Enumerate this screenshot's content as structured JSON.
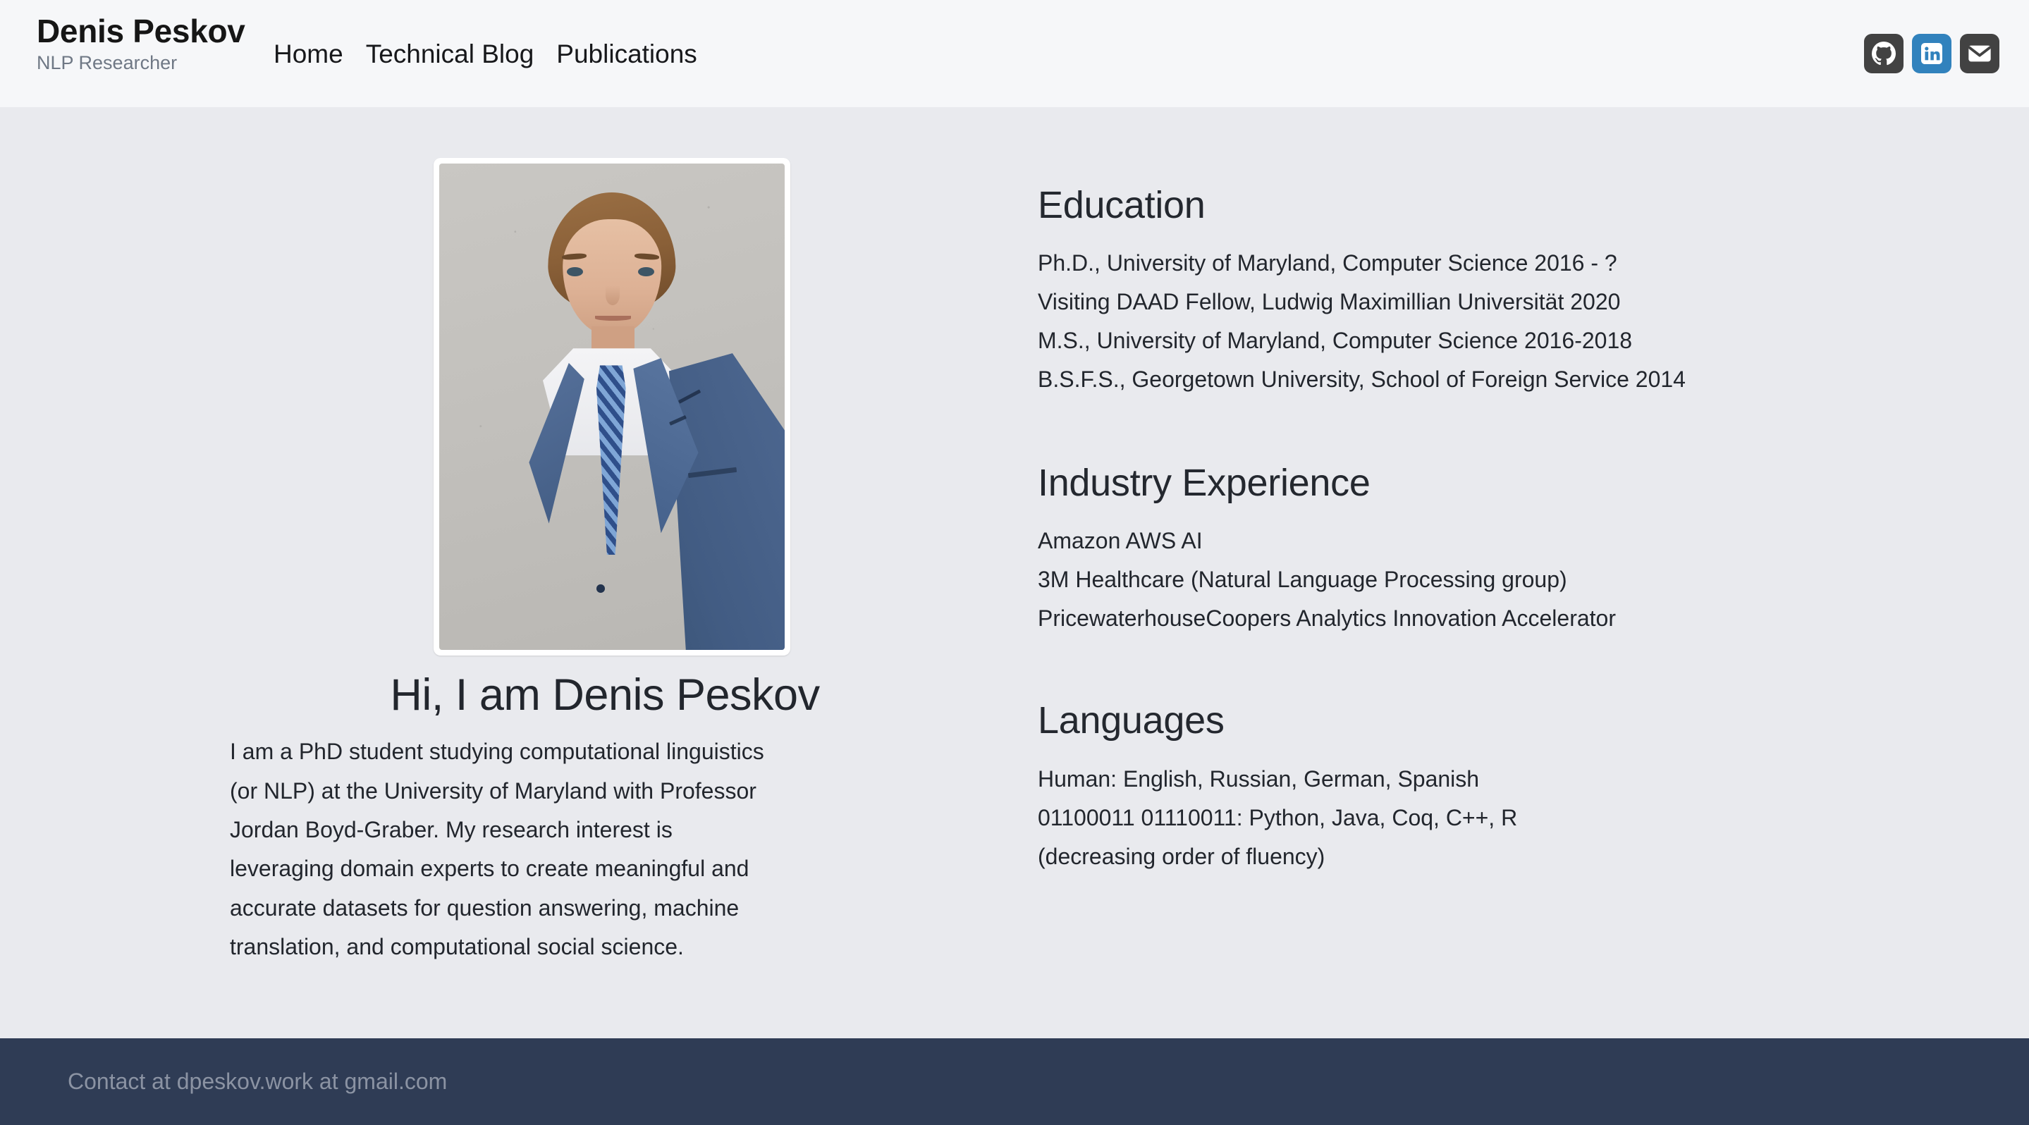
{
  "header": {
    "brand_name": "Denis Peskov",
    "brand_subtitle": "NLP Researcher",
    "nav": [
      {
        "label": "Home",
        "name": "nav-home"
      },
      {
        "label": "Technical Blog",
        "name": "nav-technical-blog"
      },
      {
        "label": "Publications",
        "name": "nav-publications"
      }
    ],
    "social": [
      {
        "icon": "github-icon",
        "color": "#424242"
      },
      {
        "icon": "linkedin-icon",
        "color": "#3182bd"
      },
      {
        "icon": "email-icon",
        "color": "#424242"
      }
    ]
  },
  "hero": {
    "photo_alt": "portrait-photo",
    "title": "Hi, I am Denis Peskov",
    "paragraph": "I am a PhD student studying computational linguistics (or NLP) at the University of Maryland with Professor Jordan Boyd-Graber. My research interest is leveraging domain experts to create meaningful and accurate datasets for question answering, machine translation, and computational social science."
  },
  "education": {
    "title": "Education",
    "lines": [
      "Ph.D., University of Maryland, Computer Science 2016 - ?",
      "Visiting DAAD Fellow, Ludwig Maximillian Universität 2020",
      "M.S., University of Maryland, Computer Science 2016-2018",
      "B.S.F.S., Georgetown University, School of Foreign Service 2014"
    ]
  },
  "industry": {
    "title": "Industry Experience",
    "lines": [
      "Amazon AWS AI",
      "3M Healthcare (Natural Language Processing group)",
      "PricewaterhouseCoopers Analytics Innovation Accelerator"
    ]
  },
  "languages": {
    "title": "Languages",
    "lines": [
      "Human: English, Russian, German, Spanish",
      "01100011 01110011: Python, Java, Coq, C++, R",
      "(decreasing order of fluency)"
    ]
  },
  "footer": {
    "contact": "Contact at dpeskov.work at gmail.com"
  },
  "colors": {
    "header_bg": "#f6f7f9",
    "page_bg": "#e9eaee",
    "footer_bg": "#2f3c55",
    "footer_text": "#8b93a3",
    "text": "#22262d",
    "muted": "#6f7885",
    "linkedin": "#3182bd",
    "dark_icon": "#424242"
  }
}
